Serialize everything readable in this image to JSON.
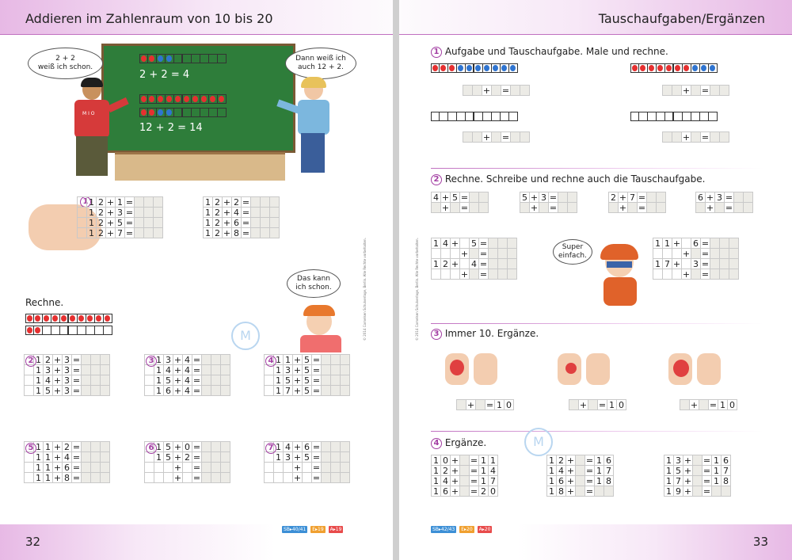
{
  "left": {
    "header": "Addieren im Zahlenraum von 10 bis 20",
    "page_number": "32",
    "badges": [
      "SB▸40/41",
      "E▸19",
      "A▸19"
    ],
    "side_note": "© 2014 Cornelsen Schulverlage, Berlin. Alle Rechte vorbehalten.",
    "bubble_boy": "2 + 2\nweiß ich schon.",
    "bubble_girl": "Dann weiß ich\nauch 12 + 2.",
    "board_line1": "2 + 2 = 4",
    "board_line2": "12 + 2 = 14",
    "shirt": "M I O",
    "bubble_girl2": "Das kann\nich schon.",
    "rechne": "Rechne.",
    "ex1": {
      "num": "1",
      "a": [
        [
          "1",
          "2",
          "+",
          "1",
          "="
        ],
        [
          "1",
          "2",
          "+",
          "3",
          "="
        ],
        [
          "1",
          "2",
          "+",
          "5",
          "="
        ],
        [
          "1",
          "2",
          "+",
          "7",
          "="
        ]
      ],
      "b": [
        [
          "1",
          "2",
          "+",
          "2",
          "="
        ],
        [
          "1",
          "2",
          "+",
          "4",
          "="
        ],
        [
          "1",
          "2",
          "+",
          "6",
          "="
        ],
        [
          "1",
          "2",
          "+",
          "8",
          "="
        ]
      ]
    },
    "ex2": {
      "num": "2",
      "rows": [
        [
          "1",
          "2",
          "+",
          "3",
          "="
        ],
        [
          "1",
          "3",
          "+",
          "3",
          "="
        ],
        [
          "1",
          "4",
          "+",
          "3",
          "="
        ],
        [
          "1",
          "5",
          "+",
          "3",
          "="
        ]
      ]
    },
    "ex3": {
      "num": "3",
      "rows": [
        [
          "1",
          "3",
          "+",
          "4",
          "="
        ],
        [
          "1",
          "4",
          "+",
          "4",
          "="
        ],
        [
          "1",
          "5",
          "+",
          "4",
          "="
        ],
        [
          "1",
          "6",
          "+",
          "4",
          "="
        ]
      ]
    },
    "ex4": {
      "num": "4",
      "rows": [
        [
          "1",
          "1",
          "+",
          "5",
          "="
        ],
        [
          "1",
          "3",
          "+",
          "5",
          "="
        ],
        [
          "1",
          "5",
          "+",
          "5",
          "="
        ],
        [
          "1",
          "7",
          "+",
          "5",
          "="
        ]
      ]
    },
    "ex5": {
      "num": "5",
      "rows": [
        [
          "1",
          "1",
          "+",
          "2",
          "="
        ],
        [
          "1",
          "1",
          "+",
          "4",
          "="
        ],
        [
          "1",
          "1",
          "+",
          "6",
          "="
        ],
        [
          "1",
          "1",
          "+",
          "8",
          "="
        ]
      ]
    },
    "ex6": {
      "num": "6",
      "rows": [
        [
          "1",
          "5",
          "+",
          "0",
          "="
        ],
        [
          "1",
          "5",
          "+",
          "2",
          "="
        ],
        [
          "",
          "",
          "+",
          "",
          "="
        ],
        [
          "",
          "",
          "+",
          "",
          "="
        ]
      ]
    },
    "ex7": {
      "num": "7",
      "rows": [
        [
          "1",
          "4",
          "+",
          "6",
          "="
        ],
        [
          "1",
          "3",
          "+",
          "5",
          "="
        ],
        [
          "",
          "",
          "+",
          "",
          "="
        ],
        [
          "",
          "",
          "+",
          "",
          "="
        ]
      ]
    }
  },
  "right": {
    "header": "Tauschaufgaben/Ergänzen",
    "page_number": "33",
    "badges": [
      "SB▸42/43",
      "E▸20",
      "A▸20"
    ],
    "side_note": "© 2014 Cornelsen Schulverlage, Berlin. Alle Rechte vorbehalten.",
    "s1": {
      "num": "1",
      "title": "Aufgabe und Tauschaufgabe. Male und rechne."
    },
    "s2": {
      "num": "2",
      "title": "Rechne. Schreibe und rechne auch die Tauschaufgabe.",
      "small": [
        [
          "4",
          "+",
          "5",
          "="
        ],
        [
          "5",
          "+",
          "3",
          "="
        ],
        [
          "2",
          "+",
          "7",
          "="
        ],
        [
          "6",
          "+",
          "3",
          "="
        ]
      ],
      "big": [
        [
          [
            "1",
            "4",
            "+",
            "",
            "5",
            "="
          ],
          [
            "1",
            "2",
            "+",
            "",
            "4",
            "="
          ]
        ],
        [
          [
            "1",
            "1",
            "+",
            "",
            "6",
            "="
          ],
          [
            "1",
            "7",
            "+",
            "",
            "3",
            "="
          ]
        ]
      ],
      "bubble": "Super\neinfach."
    },
    "s3": {
      "num": "3",
      "title": "Immer 10. Ergänze.",
      "eq": [
        "+",
        "=",
        "1",
        "0"
      ]
    },
    "s4": {
      "num": "4",
      "title": "Ergänze.",
      "a": [
        [
          "1",
          "0",
          "+",
          "",
          "=",
          "1",
          "1"
        ],
        [
          "1",
          "2",
          "+",
          "",
          "=",
          "1",
          "4"
        ],
        [
          "1",
          "4",
          "+",
          "",
          "=",
          "1",
          "7"
        ],
        [
          "1",
          "6",
          "+",
          "",
          "=",
          "2",
          "0"
        ]
      ],
      "b": [
        [
          "1",
          "2",
          "+",
          "",
          "=",
          "1",
          "6"
        ],
        [
          "1",
          "4",
          "+",
          "",
          "=",
          "1",
          "7"
        ],
        [
          "1",
          "6",
          "+",
          "",
          "=",
          "1",
          "8"
        ],
        [
          "1",
          "8",
          "+",
          "",
          "=",
          "",
          ""
        ]
      ],
      "c": [
        [
          "1",
          "3",
          "+",
          "",
          "=",
          "1",
          "6"
        ],
        [
          "1",
          "5",
          "+",
          "",
          "=",
          "1",
          "7"
        ],
        [
          "1",
          "7",
          "+",
          "",
          "=",
          "1",
          "8"
        ],
        [
          "1",
          "9",
          "+",
          "",
          "=",
          "",
          ""
        ]
      ]
    }
  },
  "colors": {
    "accent": "#a33ea3",
    "red": "#e53030",
    "blue": "#2f74d0",
    "board": "#2e7d3a"
  }
}
